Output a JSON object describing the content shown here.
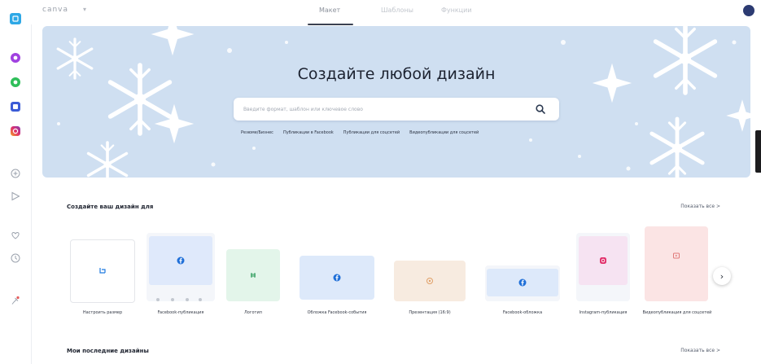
{
  "topbar": {
    "brand": "canva",
    "tabs": [
      {
        "label": "Макет"
      },
      {
        "label": "Шаблоны"
      },
      {
        "label": "Функции"
      }
    ]
  },
  "hero": {
    "title": "Создайте любой дизайн",
    "search_placeholder": "Введите формат, шаблон или ключевое слово",
    "chips": [
      "Резюме/Бизнес",
      "Публикации в Facebook",
      "Публикации для соцсетей",
      "Видеопубликации для соцсетей"
    ]
  },
  "sections": {
    "create": {
      "title": "Создайте ваш дизайн для",
      "see_all": "Показать все >"
    },
    "recent": {
      "title": "Мои последние дизайны",
      "see_all": "Показать все >"
    }
  },
  "cards": [
    {
      "label": "Настроить размер",
      "color": "#ffffff",
      "icon": "resize-icon"
    },
    {
      "label": "Facebook-публикация",
      "color": "#dfe9fb",
      "icon": "facebook-icon"
    },
    {
      "label": "Логотип",
      "color": "#e3f5ea",
      "icon": "logo-icon"
    },
    {
      "label": "Обложка Facebook-события",
      "color": "#dde9fa",
      "icon": "facebook-icon"
    },
    {
      "label": "Презентация (16:9)",
      "color": "#f7ebe0",
      "icon": "presentation-icon"
    },
    {
      "label": "Facebook-обложка",
      "color": "#dde9fa",
      "icon": "facebook-icon"
    },
    {
      "label": "Instagram-публикация",
      "color": "#f6e3f2",
      "icon": "instagram-icon"
    },
    {
      "label": "Видеопубликация для соцсетей",
      "color": "#fbe4e4",
      "icon": "video-icon"
    }
  ],
  "colors": {
    "hero_bg": "#cfdff1",
    "accent": "#1f7ae0",
    "sidebar_brand": "#2ea8e6"
  }
}
